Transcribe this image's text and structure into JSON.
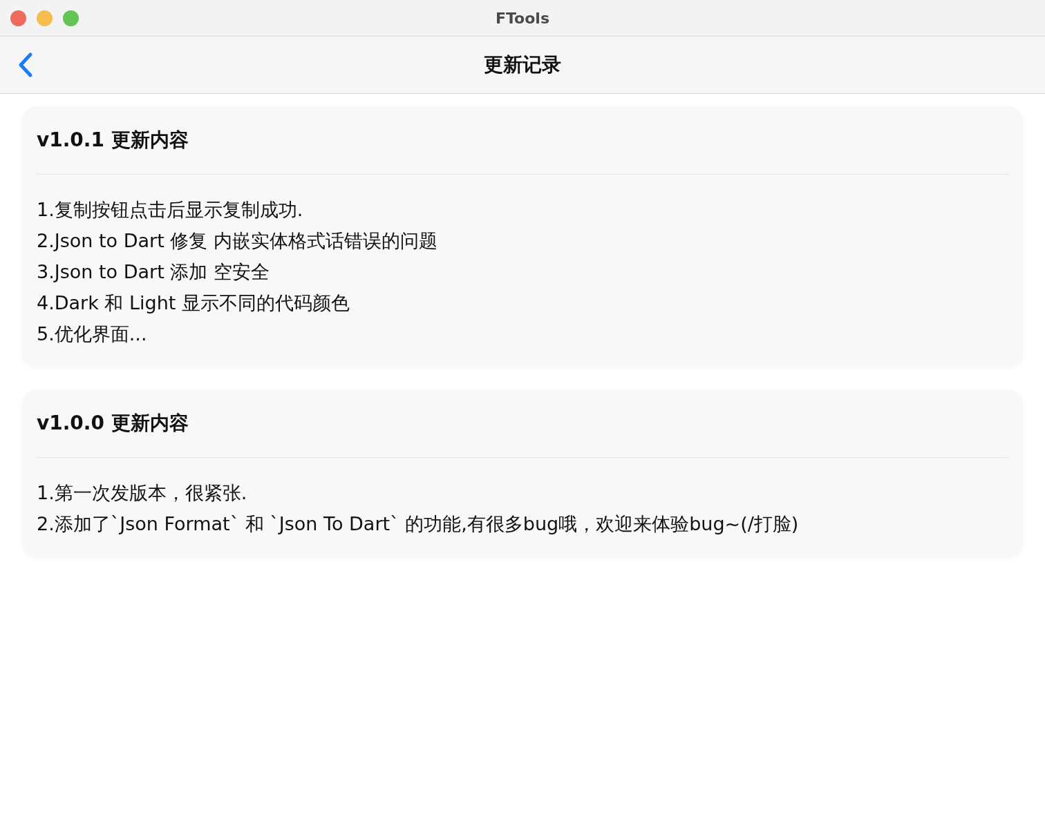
{
  "window": {
    "title": "FTools"
  },
  "nav": {
    "title": "更新记录"
  },
  "releases": [
    {
      "title": "v1.0.1 更新内容",
      "notes": [
        "1.复制按钮点击后显示复制成功.",
        "2.Json to Dart 修复 内嵌实体格式话错误的问题",
        "3.Json to Dart 添加 空安全",
        "4.Dark 和 Light 显示不同的代码颜色",
        "5.优化界面..."
      ]
    },
    {
      "title": "v1.0.0 更新内容",
      "notes": [
        "1.第一次发版本，很紧张.",
        "2.添加了`Json Format` 和 `Json To Dart` 的功能,有很多bug哦，欢迎来体验bug~(/打脸)"
      ]
    }
  ]
}
